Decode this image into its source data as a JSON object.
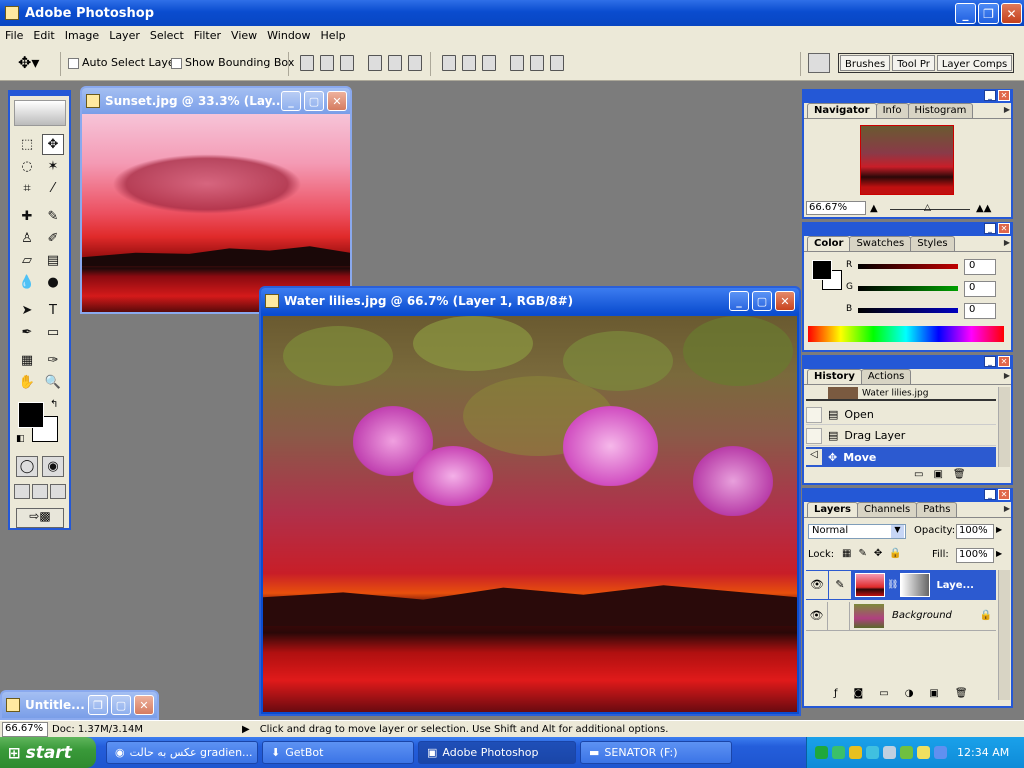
{
  "app": {
    "title": "Adobe Photoshop"
  },
  "menu": [
    "File",
    "Edit",
    "Image",
    "Layer",
    "Select",
    "Filter",
    "View",
    "Window",
    "Help"
  ],
  "options": {
    "auto_select_label": "Auto Select Layer",
    "auto_select_checked": false,
    "bounding_box_label": "Show Bounding Box",
    "bounding_box_checked": false,
    "well_tabs": [
      "Brushes",
      "Tool Pr",
      "Layer Comps"
    ]
  },
  "docs": {
    "sunset": {
      "title": "Sunset.jpg @ 33.3% (Lay..."
    },
    "lilies": {
      "title": "Water lilies.jpg @ 66.7% (Layer 1, RGB/8#)"
    },
    "untitled": {
      "title": "Untitle..."
    }
  },
  "navigator": {
    "tabs": [
      "Navigator",
      "Info",
      "Histogram"
    ],
    "zoom": "66.67%"
  },
  "color": {
    "tabs": [
      "Color",
      "Swatches",
      "Styles"
    ],
    "channels": [
      {
        "label": "R",
        "value": "0",
        "hex": "#c00000"
      },
      {
        "label": "G",
        "value": "0",
        "hex": "#00a000"
      },
      {
        "label": "B",
        "value": "0",
        "hex": "#0000c0"
      }
    ]
  },
  "history": {
    "tabs": [
      "History",
      "Actions"
    ],
    "items": [
      {
        "label": "Water lilies.jpg"
      },
      {
        "label": "Open"
      },
      {
        "label": "Drag Layer"
      },
      {
        "label": "Move"
      }
    ]
  },
  "layers": {
    "tabs": [
      "Layers",
      "Channels",
      "Paths"
    ],
    "blend_mode": "Normal",
    "opacity_label": "Opacity:",
    "opacity": "100%",
    "lock_label": "Lock:",
    "fill_label": "Fill:",
    "fill": "100%",
    "items": [
      {
        "name": "Laye..."
      },
      {
        "name": "Background"
      }
    ]
  },
  "status": {
    "zoom": "66.67%",
    "doc": "Doc: 1.37M/3.14M",
    "hint": "Click and drag to move layer or selection.  Use Shift and Alt for additional options."
  },
  "taskbar": {
    "start": "start",
    "tasks": [
      "عکس به حالت gradien...",
      "GetBot",
      "Adobe Photoshop",
      "SENATOR (F:)"
    ],
    "clock": "12:34 AM"
  }
}
